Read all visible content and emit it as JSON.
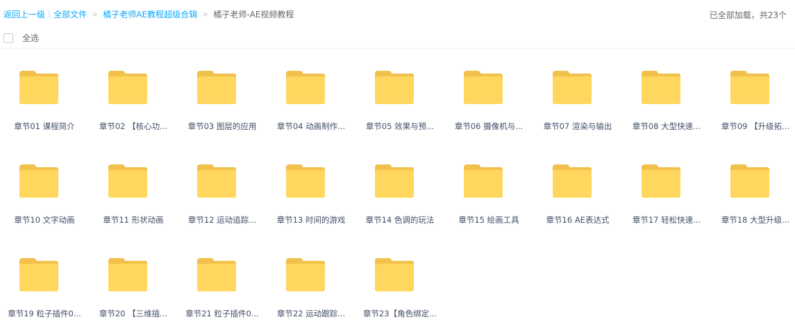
{
  "breadcrumb": {
    "back": "返回上一级",
    "all_files": "全部文件",
    "parent": "橘子老师AE教程超级合辑",
    "current": "橘子老师-AE视频教程",
    "separator": ">",
    "divider": "|"
  },
  "status": {
    "loaded": "已全部加载，共23个"
  },
  "select_all": {
    "label": "全选"
  },
  "colors": {
    "link": "#09aaff",
    "folder_front": "#ffd75e",
    "folder_back": "#f1c14c"
  },
  "files": [
    {
      "name": "章节01 课程简介",
      "icon": "folder-icon"
    },
    {
      "name": "章节02 【核心功...",
      "icon": "folder-icon"
    },
    {
      "name": "章节03 图层的应用",
      "icon": "folder-icon"
    },
    {
      "name": "章节04 动画制作...",
      "icon": "folder-icon"
    },
    {
      "name": "章节05 效果与预...",
      "icon": "folder-icon"
    },
    {
      "name": "章节06 摄像机与...",
      "icon": "folder-icon"
    },
    {
      "name": "章节07 渲染与输出",
      "icon": "folder-icon"
    },
    {
      "name": "章节08 大型快速...",
      "icon": "folder-icon"
    },
    {
      "name": "章节09 【升级拓...",
      "icon": "folder-icon"
    },
    {
      "name": "章节10 文字动画",
      "icon": "folder-icon"
    },
    {
      "name": "章节11 形状动画",
      "icon": "folder-icon"
    },
    {
      "name": "章节12 运动追踪...",
      "icon": "folder-icon"
    },
    {
      "name": "章节13 时间的游戏",
      "icon": "folder-icon"
    },
    {
      "name": "章节14 色调的玩法",
      "icon": "folder-icon"
    },
    {
      "name": "章节15 绘画工具",
      "icon": "folder-icon"
    },
    {
      "name": "章节16 AE表达式",
      "icon": "folder-icon"
    },
    {
      "name": "章节17 轻松快速...",
      "icon": "folder-icon"
    },
    {
      "name": "章节18 大型升级...",
      "icon": "folder-icon"
    },
    {
      "name": "章节19 粒子插件0...",
      "icon": "folder-icon"
    },
    {
      "name": "章节20 【三维插...",
      "icon": "folder-icon"
    },
    {
      "name": "章节21 粒子插件0...",
      "icon": "folder-icon"
    },
    {
      "name": "章节22 运动跟踪...",
      "icon": "folder-icon"
    },
    {
      "name": "章节23【角色绑定...",
      "icon": "folder-icon"
    }
  ]
}
